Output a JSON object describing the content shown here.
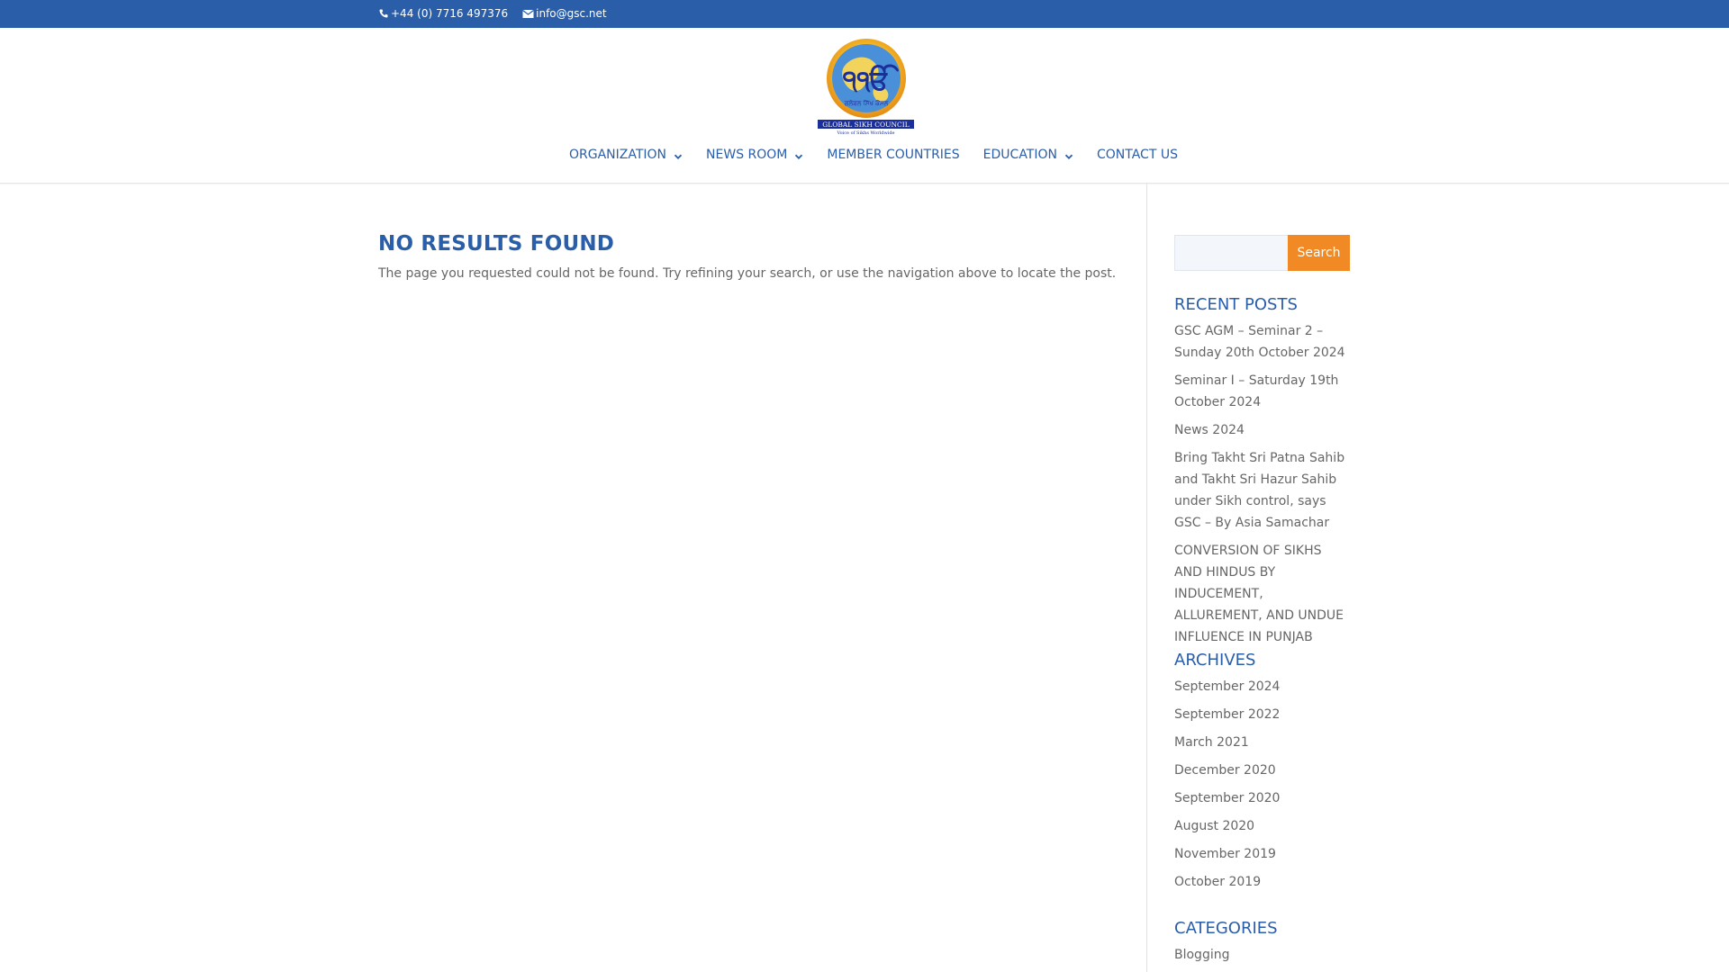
{
  "topbar": {
    "phone": "+44 (0) 7716 497376",
    "email": "info@gsc.net",
    "background_color": "#2a5ea8"
  },
  "logo": {
    "glyph": "੧ੴ",
    "main_text": "GLOBAL SIKH COUNCIL",
    "tagline": "Voice of Sikhs Worldwide",
    "script_text": "ਗਲੋਬਲ ਸਿੱਖ ਕੌਂਸਲ"
  },
  "nav": {
    "items": [
      {
        "label": "ORGANIZATION",
        "has_dropdown": true
      },
      {
        "label": "NEWS ROOM",
        "has_dropdown": true
      },
      {
        "label": "MEMBER COUNTRIES",
        "has_dropdown": false
      },
      {
        "label": "EDUCATION",
        "has_dropdown": true
      },
      {
        "label": "CONTACT US",
        "has_dropdown": false
      }
    ],
    "color": "#2a5ea8"
  },
  "main": {
    "title": "NO RESULTS FOUND",
    "message": "The page you requested could not be found. Try refining your search, or use the navigation above to locate the post."
  },
  "sidebar": {
    "search": {
      "button_label": "Search",
      "value": ""
    },
    "recent_posts": {
      "heading": "RECENT POSTS",
      "items": [
        "GSC AGM – Seminar 2 – Sunday 20th October 2024",
        "Seminar I – Saturday 19th October 2024",
        "News 2024",
        "Bring Takht Sri Patna Sahib and Takht Sri Hazur Sahib under Sikh control, says GSC – By Asia Samachar",
        "CONVERSION OF SIKHS AND HINDUS BY INDUCEMENT, ALLUREMENT, AND UNDUE INFLUENCE IN PUNJAB"
      ]
    },
    "archives": {
      "heading": "ARCHIVES",
      "items": [
        "September 2024",
        "September 2022",
        "March 2021",
        "December 2020",
        "September 2020",
        "August 2020",
        "November 2019",
        "October 2019"
      ]
    },
    "categories": {
      "heading": "CATEGORIES",
      "items": [
        "Blogging"
      ]
    },
    "accent_color": "#f18a25"
  }
}
